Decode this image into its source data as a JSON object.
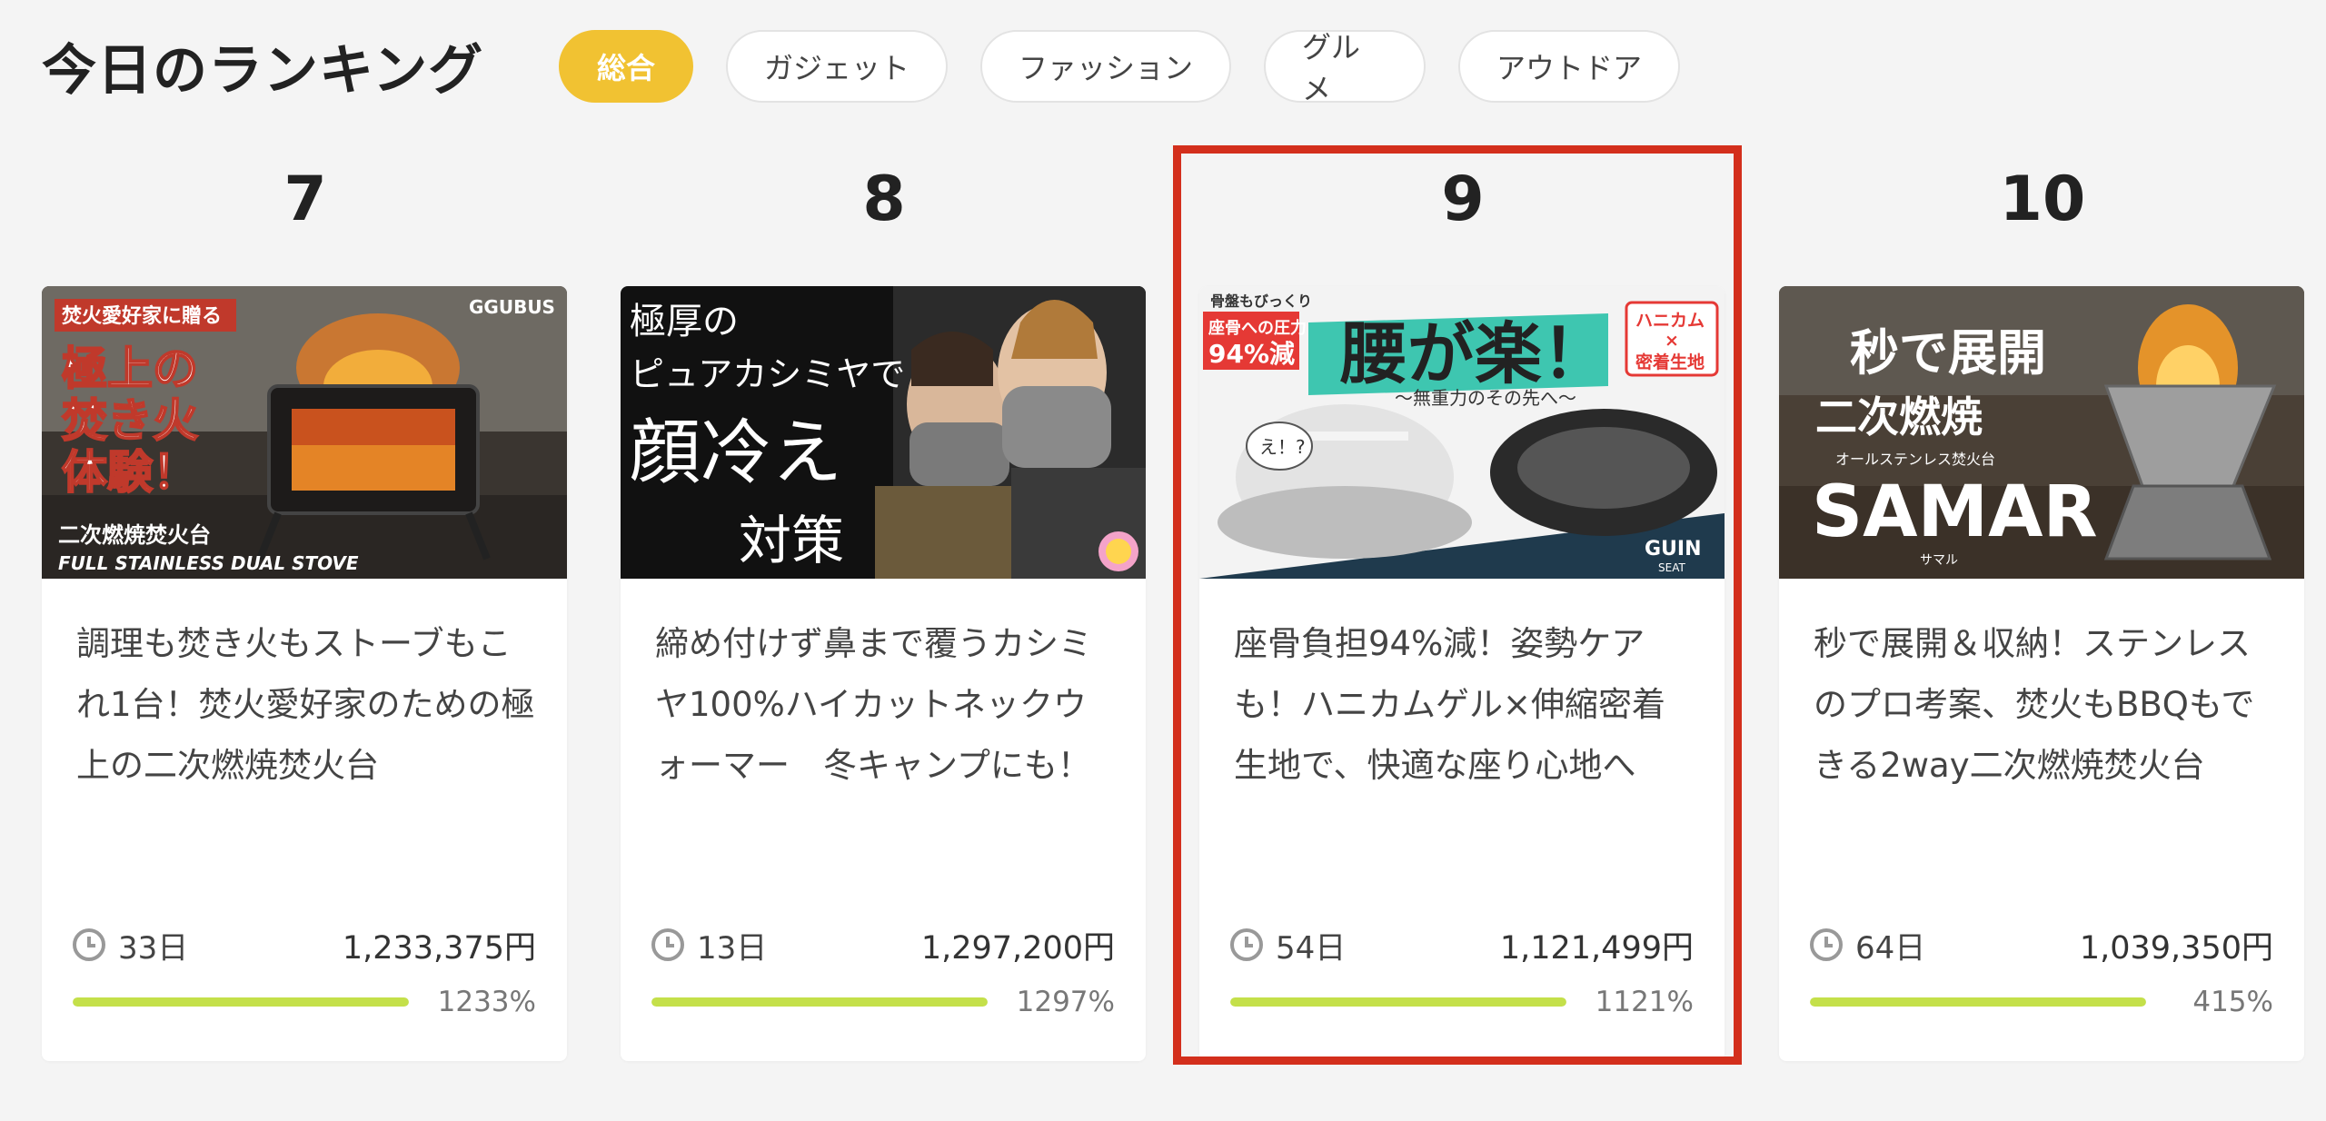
{
  "header": {
    "title": "今日のランキング"
  },
  "tabs": [
    {
      "label": "総合",
      "active": true
    },
    {
      "label": "ガジェット",
      "active": false
    },
    {
      "label": "ファッション",
      "active": false
    },
    {
      "label": "グルメ",
      "active": false
    },
    {
      "label": "アウトドア",
      "active": false
    }
  ],
  "colors": {
    "accent": "#f1c232",
    "progress": "#c4e04a",
    "highlight": "#d32f1c"
  },
  "cards": [
    {
      "rank": "7",
      "desc": "調理も焚き火もストーブもこれ1台！焚火愛好家のための極上の二次燃焼焚火台",
      "days": "33日",
      "amount": "1,233,375円",
      "percent": "1233%",
      "progress": 1.0,
      "image": {
        "tag": "焚火愛好家に贈る",
        "brand": "GGUBUS",
        "headline": [
          "極上の",
          "焚き火",
          "体験！"
        ],
        "sub1": "二次燃焼焚火台",
        "sub2": "FULL STAINLESS DUAL STOVE"
      }
    },
    {
      "rank": "8",
      "desc": "締め付けず鼻まで覆うカシミヤ100%ハイカットネックウォーマー　冬キャンプにも！",
      "days": "13日",
      "amount": "1,297,200円",
      "percent": "1297%",
      "progress": 1.0,
      "image": {
        "line1": "極厚の",
        "line2": "ピュアカシミヤで",
        "line3": "顔冷え",
        "line4": "対策"
      }
    },
    {
      "rank": "9",
      "desc": "座骨負担94%減！姿勢ケアも！ハニカムゲル×伸縮密着生地で、快適な座り心地へ",
      "days": "54日",
      "amount": "1,121,499円",
      "percent": "1121%",
      "progress": 1.0,
      "image": {
        "small": "骨盤もびっくり",
        "tag1": "座骨への圧力",
        "tag2": "94%減",
        "headline": "腰が楽！",
        "box1": "ハニカム",
        "box2": "×",
        "box3": "密着生地",
        "sub": "〜無重力のその先へ〜",
        "bubble": "え！?",
        "brand": "GUIN",
        "brand_sub": "SEAT"
      }
    },
    {
      "rank": "10",
      "desc": "秒で展開＆収納！ステンレスのプロ考案、焚火もBBQもできる2way二次燃焼焚火台",
      "days": "64日",
      "amount": "1,039,350円",
      "percent": "415%",
      "progress": 1.0,
      "image": {
        "line1": "秒で展開",
        "line2": "二次燃焼",
        "small": "オールステンレス焚火台",
        "name": "SAMAR",
        "kana": "サマル"
      }
    }
  ]
}
